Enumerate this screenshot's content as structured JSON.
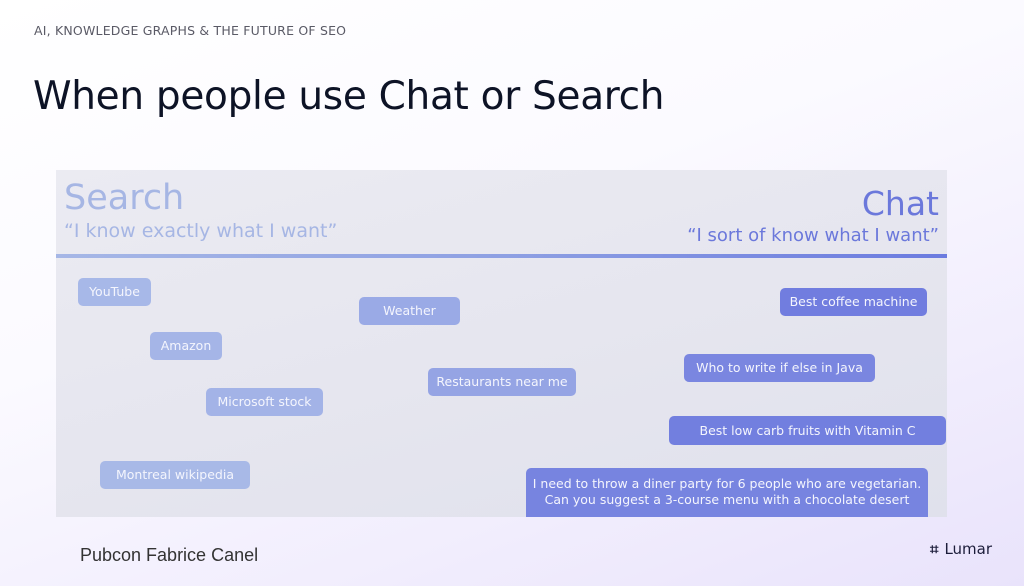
{
  "header": {
    "kicker": "AI, KNOWLEDGE GRAPHS & THE FUTURE OF SEO",
    "title": "When people use Chat or Search"
  },
  "diagram": {
    "left_heading": "Search",
    "left_subheading": "“I know exactly what I want”",
    "right_heading": "Chat",
    "right_subheading": "“I sort of know what I want”",
    "colors": {
      "search": "#a6b7e6",
      "chat": "#6b7bdf"
    },
    "queries": [
      {
        "label": "YouTube",
        "spectrum": 0.0
      },
      {
        "label": "Amazon",
        "spectrum": 0.1
      },
      {
        "label": "Microsoft stock",
        "spectrum": 0.2
      },
      {
        "label": "Montreal wikipedia",
        "spectrum": 0.15
      },
      {
        "label": "Weather",
        "spectrum": 0.45
      },
      {
        "label": "Restaurants near me",
        "spectrum": 0.55
      },
      {
        "label": "Best coffee machine",
        "spectrum": 0.9
      },
      {
        "label": "Who to write if else in Java",
        "spectrum": 0.85
      },
      {
        "label": "Best low carb fruits with Vitamin C",
        "spectrum": 0.95
      },
      {
        "label": "I need to throw a diner party for 6 people who are vegetarian.\nCan you suggest a 3-course menu with a chocolate desert",
        "spectrum": 1.0
      }
    ]
  },
  "footer": {
    "presenter": "Pubcon Fabrice Canel",
    "brand": "Lumar",
    "brand_icon": "asterisk-hash-icon"
  }
}
